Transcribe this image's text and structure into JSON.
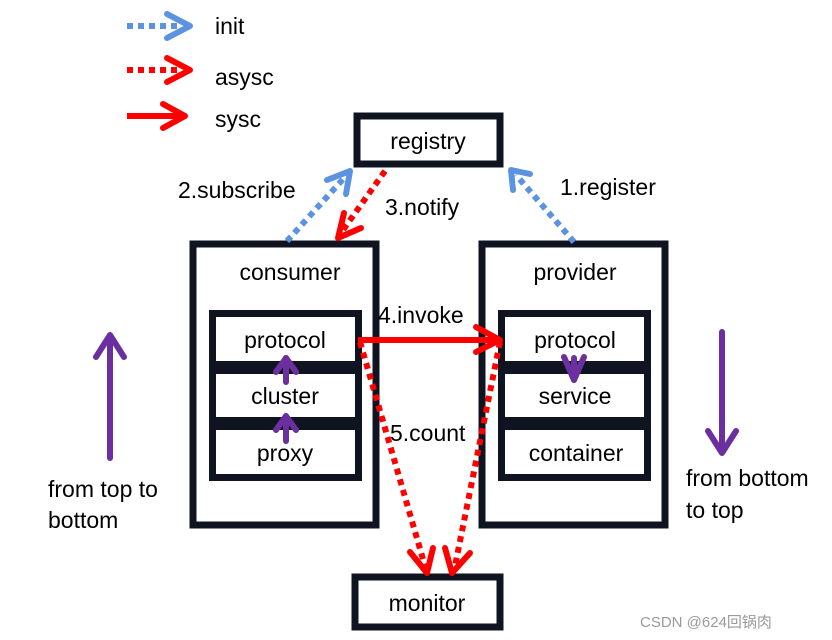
{
  "legend": [
    {
      "label": "init",
      "style": "dotted",
      "color": "#5b93e0"
    },
    {
      "label": "asysc",
      "style": "dotted",
      "color": "#ff0000"
    },
    {
      "label": "sysc",
      "style": "solid",
      "color": "#ff0000"
    }
  ],
  "nodes": {
    "registry": "registry",
    "consumer": {
      "title": "consumer",
      "layers": [
        "protocol",
        "cluster",
        "proxy"
      ]
    },
    "provider": {
      "title": "provider",
      "layers": [
        "protocol",
        "service",
        "container"
      ]
    },
    "monitor": "monitor"
  },
  "edges": {
    "register": "1.register",
    "subscribe": "2.subscribe",
    "notify": "3.notify",
    "invoke": "4.invoke",
    "count": "5.count"
  },
  "side_notes": {
    "left": [
      "from top to",
      "bottom"
    ],
    "right": [
      "from bottom",
      "to top"
    ]
  },
  "colors": {
    "purple": "#6b2fa0",
    "box": "#0f1420"
  },
  "watermark": "CSDN @624回锅肉"
}
